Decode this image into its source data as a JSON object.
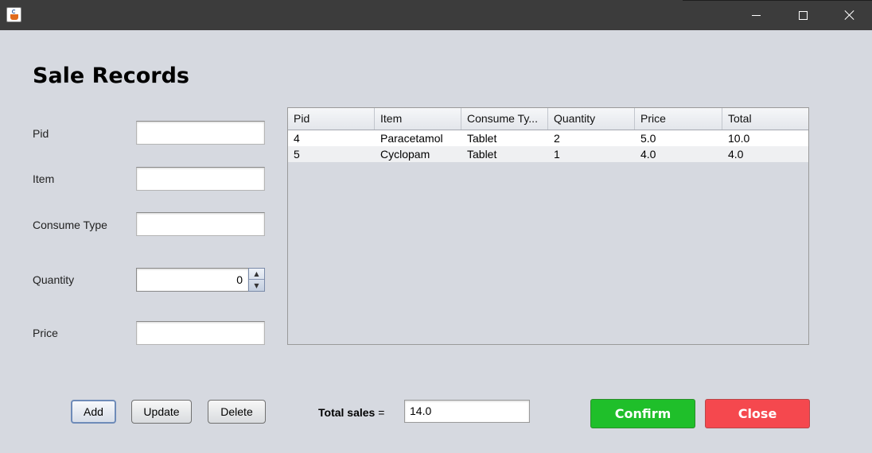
{
  "window": {
    "icon": "java-coffee-icon",
    "controls": {
      "minimize": "minimize-icon",
      "maximize": "maximize-icon",
      "close": "close-icon"
    }
  },
  "page": {
    "title": "Sale Records"
  },
  "form": {
    "pid_label": "Pid",
    "pid_value": "",
    "item_label": "Item",
    "item_value": "",
    "consume_type_label": "Consume Type",
    "consume_type_value": "",
    "quantity_label": "Quantity",
    "quantity_value": "0",
    "spin_up": "▲",
    "spin_down": "▼",
    "price_label": "Price",
    "price_value": ""
  },
  "table": {
    "columns": [
      "Pid",
      "Item",
      "Consume Ty...",
      "Quantity",
      "Price",
      "Total"
    ],
    "rows": [
      [
        "4",
        "Paracetamol",
        "Tablet",
        "2",
        "5.0",
        "10.0"
      ],
      [
        "5",
        "Cyclopam",
        "Tablet",
        "1",
        "4.0",
        "4.0"
      ]
    ]
  },
  "actions": {
    "add_label": "Add",
    "update_label": "Update",
    "delete_label": "Delete"
  },
  "totals": {
    "label": "Total sales",
    "equals": "=",
    "value": "14.0"
  },
  "footer": {
    "confirm_label": "Confirm",
    "close_label": "Close"
  },
  "colors": {
    "confirm": "#1fbf2a",
    "close": "#f5484e",
    "background": "#d6d9e0",
    "titlebar": "#3c3c3c"
  }
}
